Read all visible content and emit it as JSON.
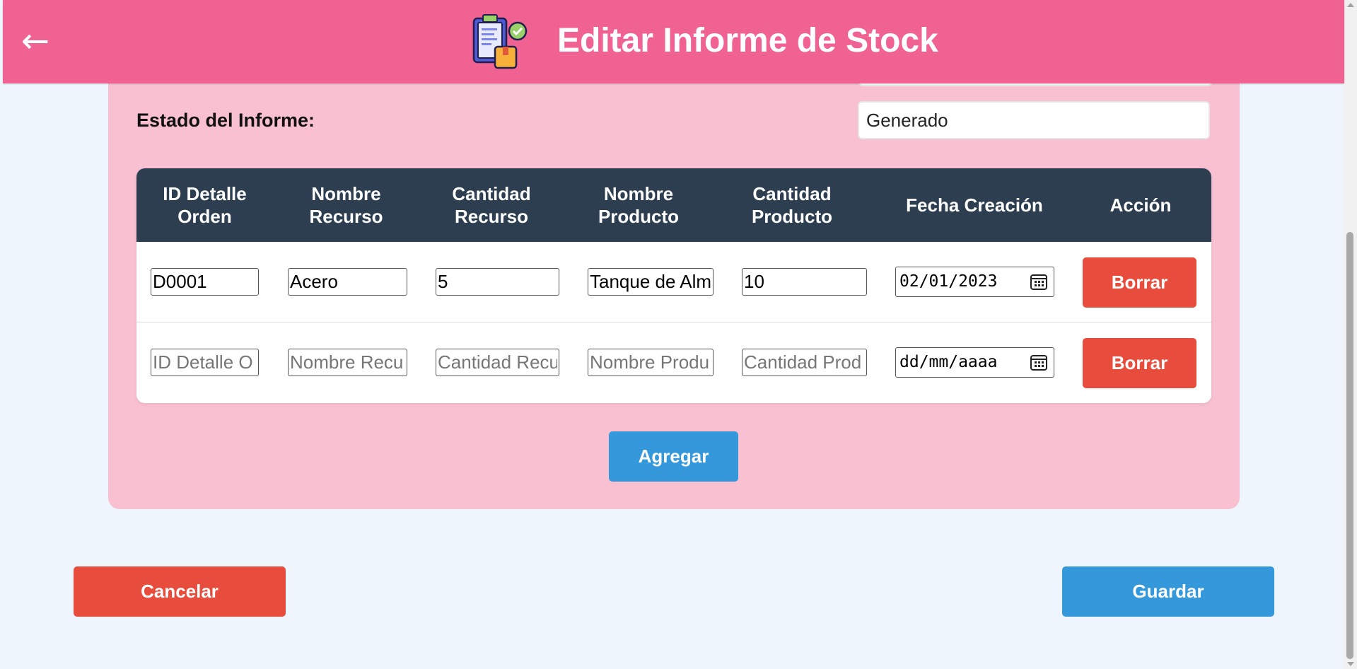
{
  "header": {
    "back_icon": "left-arrow-icon",
    "logo_icon": "clipboard-report-icon",
    "title": "Editar Informe de Stock"
  },
  "form": {
    "estado_label": "Estado del Informe:",
    "estado_value": "Generado"
  },
  "table": {
    "headers": [
      "ID Detalle Orden",
      "Nombre Recurso",
      "Cantidad Recurso",
      "Nombre Producto",
      "Cantidad Producto",
      "Fecha Creación",
      "Acción"
    ],
    "rows": [
      {
        "id_detalle": "D0001",
        "nombre_recurso": "Acero",
        "cantidad_recurso": "5",
        "nombre_producto": "Tanque de Alm",
        "cantidad_producto": "10",
        "fecha": "02/01/2023",
        "accion": "Borrar"
      },
      {
        "id_detalle": "",
        "nombre_recurso": "",
        "cantidad_recurso": "",
        "nombre_producto": "",
        "cantidad_producto": "",
        "fecha": "dd/mm/aaaa",
        "accion": "Borrar"
      }
    ],
    "placeholders": {
      "id_detalle": "ID Detalle O",
      "nombre_recurso": "Nombre Recu",
      "cantidad_recurso": "Cantidad Recu",
      "nombre_producto": "Nombre Produ",
      "cantidad_producto": "Cantidad Prod"
    }
  },
  "buttons": {
    "agregar": "Agregar",
    "cancelar": "Cancelar",
    "guardar": "Guardar"
  },
  "colors": {
    "header_bg": "#f06292",
    "card_bg": "#f8c0d0",
    "table_header_bg": "#2c3e50",
    "danger": "#e74c3c",
    "primary": "#3498db",
    "page_bg": "#eef5fd"
  }
}
